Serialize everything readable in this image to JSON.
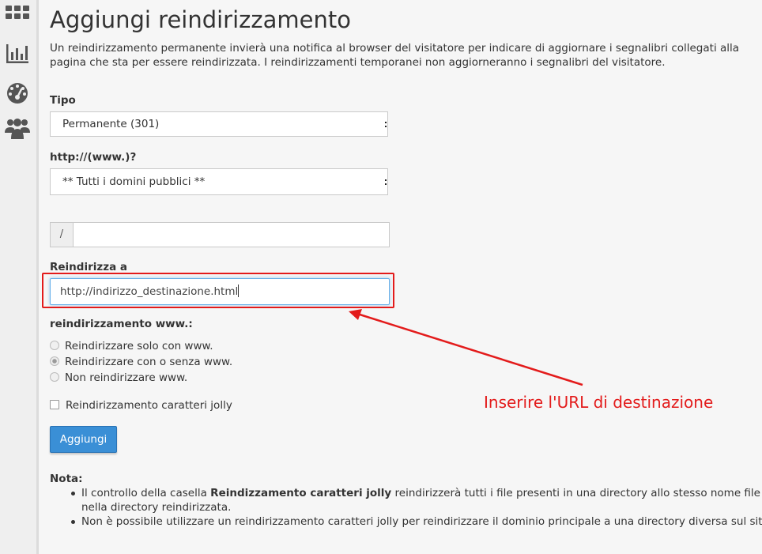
{
  "sidebar": {
    "icons": [
      "grid-icon",
      "stats-icon",
      "gauge-icon",
      "users-icon"
    ]
  },
  "page": {
    "title": "Aggiungi reindirizzamento",
    "intro": "Un reindirizzamento permanente invierà una notifica al browser del visitatore per indicare di aggiornare i segnalibri collegati alla pagina che sta per essere reindirizzata. I reindirizzamenti temporanei non aggiorneranno i segnalibri del visitatore."
  },
  "form": {
    "type_label": "Tipo",
    "type_value": "Permanente (301)",
    "domain_label": "http://(www.)?",
    "domain_value": "** Tutti i domini pubblici **",
    "path_prefix": "/",
    "path_value": "",
    "redirect_label": "Reindirizza a",
    "redirect_value": "http://indirizzo_destinazione.html",
    "www_label": "reindirizzamento www.:",
    "www_options": [
      {
        "label": "Reindirizzare solo con www.",
        "checked": false
      },
      {
        "label": "Reindirizzare con o senza www.",
        "checked": true
      },
      {
        "label": "Non reindirizzare www.",
        "checked": false
      }
    ],
    "wildcard_label": "Reindirizzamento caratteri jolly",
    "wildcard_checked": false,
    "submit_label": "Aggiungi"
  },
  "notes": {
    "title": "Nota:",
    "item1_pre": "Il controllo della casella ",
    "item1_bold": "Reindizzamento caratteri jolly",
    "item1_post": " reindirizzerà tutti i file presenti in una directory allo stesso nome file nella directory reindirizzata.",
    "item2": "Non è possibile utilizzare un reindirizzamento caratteri jolly per reindirizzare il dominio principale a una directory diversa sul sito."
  },
  "annotation": {
    "text": "Inserire l'URL di destinazione",
    "color": "#e31b1b"
  },
  "colors": {
    "primary_button": "#3a8fd6",
    "focus_border": "#66afe9"
  }
}
